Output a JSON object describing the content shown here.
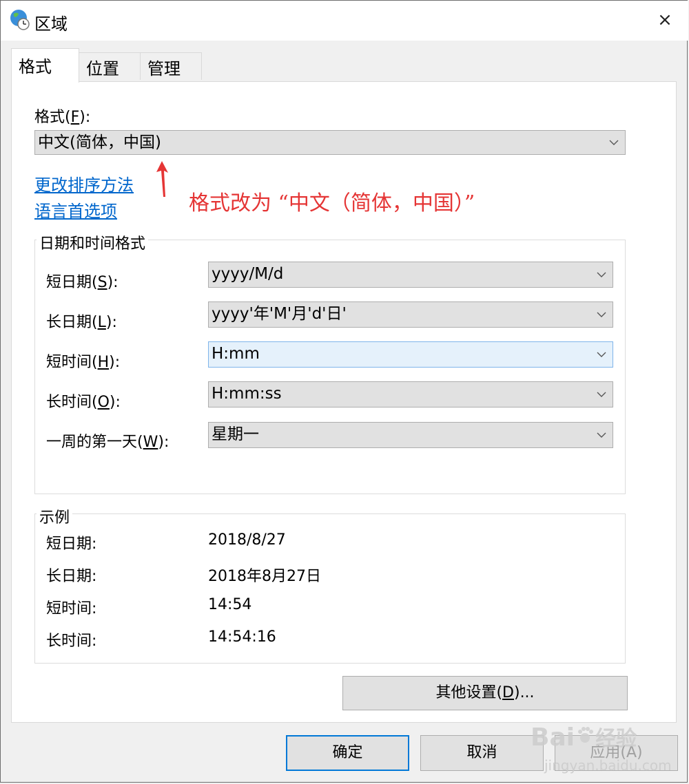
{
  "window": {
    "title": "区域",
    "close_glyph": "×"
  },
  "tabs": [
    {
      "label": "格式",
      "active": true
    },
    {
      "label": "位置",
      "active": false
    },
    {
      "label": "管理",
      "active": false
    }
  ],
  "format": {
    "label": "格式",
    "label_key": "F",
    "label_suffix": "):",
    "selected": "中文(简体，中国)"
  },
  "links": {
    "sort_method": "更改排序方法",
    "language_prefs": "语言首选项"
  },
  "annotation": {
    "text": "格式改为 “中文（简体，中国）”",
    "color": "#e53535"
  },
  "datetime_group": {
    "title": "日期和时间格式",
    "rows": [
      {
        "label": "短日期(",
        "key": "S",
        "suffix": "):",
        "value": "yyyy/M/d"
      },
      {
        "label": "长日期(",
        "key": "L",
        "suffix": "):",
        "value": "yyyy'年'M'月'd'日'"
      },
      {
        "label": "短时间(",
        "key": "H",
        "suffix": "):",
        "value": "H:mm"
      },
      {
        "label": "长时间(",
        "key": "O",
        "suffix": "):",
        "value": "H:mm:ss"
      },
      {
        "label": "一周的第一天(",
        "key": "W",
        "suffix": "):",
        "value": "星期一"
      }
    ]
  },
  "example_group": {
    "title": "示例",
    "rows": [
      {
        "label": "短日期:",
        "value": "2018/8/27"
      },
      {
        "label": "长日期:",
        "value": "2018年8月27日"
      },
      {
        "label": "短时间:",
        "value": "14:54"
      },
      {
        "label": "长时间:",
        "value": "14:54:16"
      }
    ]
  },
  "buttons": {
    "other_settings": {
      "prefix": "其他设置(",
      "key": "D",
      "suffix": ")..."
    },
    "ok": "确定",
    "cancel": "取消",
    "apply": "应用(A)"
  },
  "watermark": {
    "brand": "Bai",
    "brand2": "经验",
    "url": "jingyan.baidu.com"
  },
  "colors": {
    "accent": "#0078d7",
    "link": "#0066cc",
    "annotation": "#e53535"
  }
}
